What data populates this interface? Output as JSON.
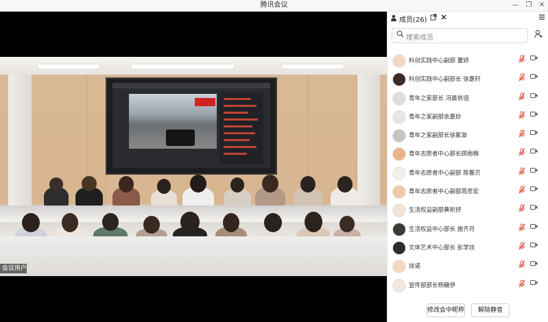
{
  "window": {
    "title": "腾讯会议",
    "controls": {
      "minimize": "—",
      "restore": "❐",
      "close": "✕"
    }
  },
  "video": {
    "user_label": "会议用户"
  },
  "panel": {
    "title": "成员(26)",
    "search_placeholder": "搜索成员",
    "members": [
      {
        "name": "科创实践中心副部 董妍",
        "avatar_color": "#f2d9c4"
      },
      {
        "name": "科创实践中心副部长 徐嘉轩",
        "avatar_color": "#3a2a2a"
      },
      {
        "name": "青年之家部长 冯晨依徂",
        "avatar_color": "#dcdcdc"
      },
      {
        "name": "青年之家副部余嘉妙",
        "avatar_color": "#e9e2e6"
      },
      {
        "name": "青年之家副部长徐紫漩",
        "avatar_color": "#c9c3bf"
      },
      {
        "name": "青年志愿者中心部长顾雨楠",
        "avatar_color": "#e9b48a"
      },
      {
        "name": "青年志愿者中心副部 陈馨贝",
        "avatar_color": "#f2efe9"
      },
      {
        "name": "青年志愿者中心副部周彦宏",
        "avatar_color": "#f0c9a6"
      },
      {
        "name": "生活权益副部黄昕妤",
        "avatar_color": "#f3e1d2"
      },
      {
        "name": "生活权益中心部长 施齐月",
        "avatar_color": "#3c3a36"
      },
      {
        "name": "文体艺术中心部长 彭学炫",
        "avatar_color": "#2c2c30"
      },
      {
        "name": "徐诺",
        "avatar_color": "#f6d7c2"
      },
      {
        "name": "宣传部部长杨糖伊",
        "avatar_color": "#f4e6dc"
      }
    ],
    "footer": {
      "rename_button": "修改会中昵称",
      "unmute_button": "解除静音"
    }
  },
  "icons": {
    "members": "person-icon",
    "popout": "popout-icon",
    "close": "close-icon",
    "menu": "menu-icon",
    "search": "search-icon",
    "invite": "invite-icon",
    "mic_muted": "mic-muted-icon",
    "camera": "camera-icon"
  },
  "colors": {
    "muted_mic": "#e0453a",
    "stage_bg": "#000000",
    "panel_bg": "#ffffff"
  }
}
